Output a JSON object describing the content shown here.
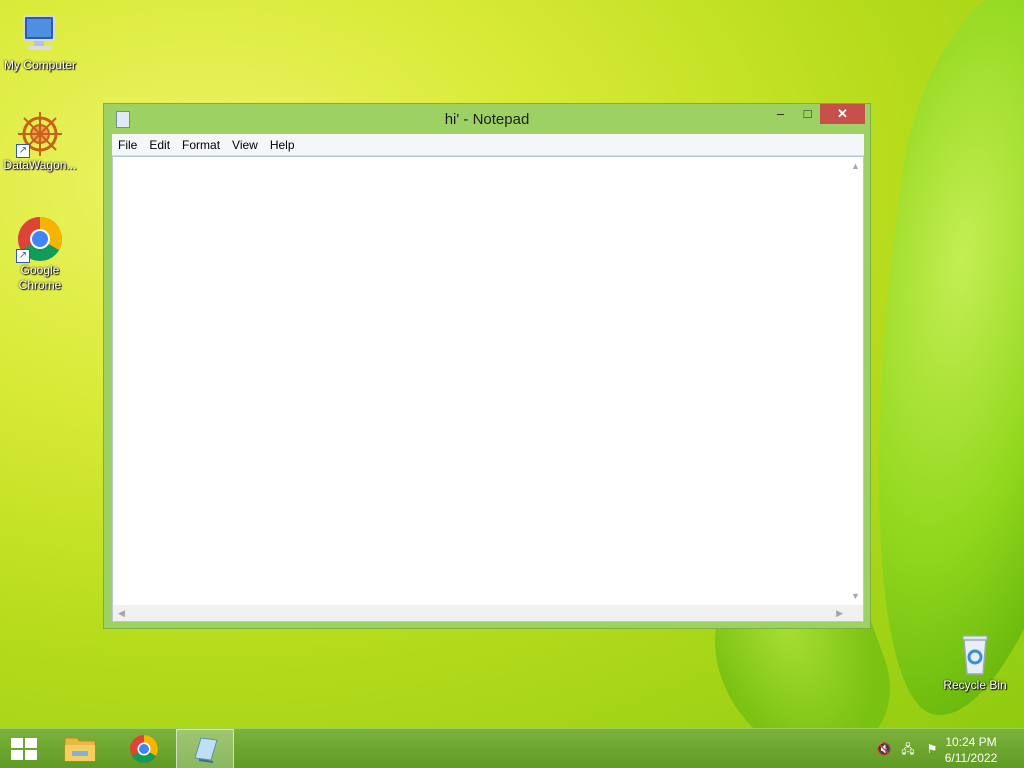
{
  "desktop": {
    "icons": [
      {
        "label": "My Computer"
      },
      {
        "label": "DataWagon..."
      },
      {
        "label": "Google Chrome"
      },
      {
        "label": "Recycle Bin"
      }
    ]
  },
  "notepad": {
    "title": "hi' - Notepad",
    "controls": {
      "minimize": "–",
      "maximize": "□",
      "close": "✕"
    },
    "menu": [
      "File",
      "Edit",
      "Format",
      "View",
      "Help"
    ],
    "content": ""
  },
  "taskbar": {
    "items": [
      {
        "icon": "windows-start-icon"
      },
      {
        "icon": "file-explorer-icon"
      },
      {
        "icon": "chrome-icon"
      },
      {
        "icon": "notepad-icon"
      }
    ],
    "tray": {
      "icons": [
        "speaker-muted-icon",
        "network-icon",
        "action-center-flag-icon"
      ],
      "time": "10:24 PM",
      "date": "6/11/2022"
    }
  },
  "colors": {
    "window_frame": "#9ed164",
    "close_button": "#c7504b",
    "taskbar": "#6aa52e"
  }
}
